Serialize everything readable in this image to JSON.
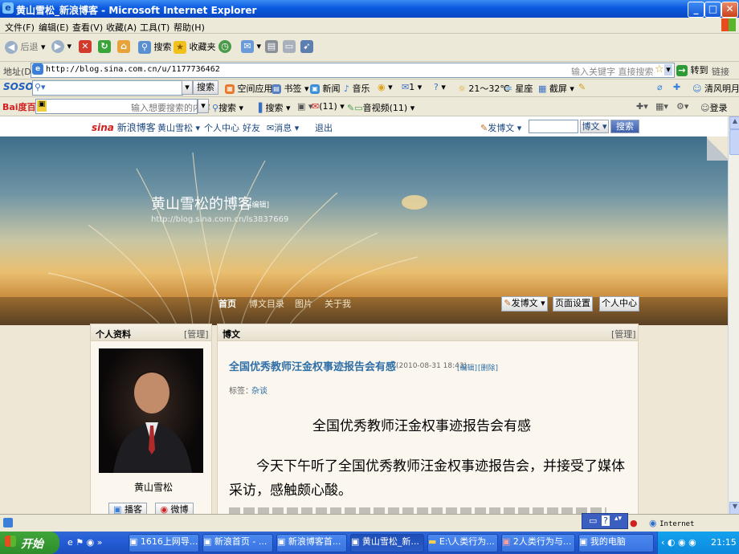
{
  "window": {
    "title": "黄山雪松_新浪博客 - Microsoft Internet Explorer",
    "min": "_",
    "max": "□",
    "close": "✕"
  },
  "menu": [
    "文件(F)",
    "编辑(E)",
    "查看(V)",
    "收藏(A)",
    "工具(T)",
    "帮助(H)"
  ],
  "toolbar": {
    "back": "后退",
    "search": "搜索",
    "favorites": "收藏夹"
  },
  "address": {
    "label": "地址(D)",
    "url": "http://blog.sina.com.cn/u/1177736462",
    "hint": "输入关键字 直接搜索",
    "go": "转到",
    "links": "链接"
  },
  "soso_bar": {
    "logo": "SOSO",
    "search_btn": "搜索",
    "items": [
      "空间应用",
      "书签",
      "新闻",
      "音乐",
      "1",
      "21～32℃",
      "星座",
      "截屏"
    ],
    "user": "清风明月"
  },
  "baidu_bar": {
    "logo": "Bai度百度",
    "placeholder": "输入想要搜索的内容",
    "search_btn": "搜索",
    "items": [
      "搜索",
      "(11)",
      "音视频(11)"
    ],
    "login": "登录"
  },
  "sina_bar": {
    "logo": "新浪博客",
    "user": "黄山雪松",
    "items": [
      "个人中心",
      "好友",
      "消息",
      "退出"
    ],
    "post": "发博文",
    "search_scope": "博文",
    "search_btn": "搜索"
  },
  "blog": {
    "title": "黄山雪松的博客",
    "edit": "[编辑]",
    "url": "http://blog.sina.com.cn/ls3837669",
    "nav": [
      "首页",
      "博文目录",
      "图片",
      "关于我"
    ],
    "actions": [
      "发博文",
      "页面设置",
      "个人中心"
    ]
  },
  "profile": {
    "heading": "个人资料",
    "manage": "[管理]",
    "name": "黄山雪松",
    "btn1": "播客",
    "btn2": "微博"
  },
  "post": {
    "heading": "博文",
    "manage": "[管理]",
    "title": "全国优秀教师汪金权事迹报告会有感",
    "date": "(2010-08-31 18:43)",
    "edit": "[编辑]",
    "delete": "[删除]",
    "tag_label": "标签：",
    "tag": "杂谈",
    "body_title": "全国优秀教师汪金权事迹报告会有感",
    "para1": "今天下午听了全国优秀教师汪金权事迹报告会，并接受了媒体采访，感触颇心酸。"
  },
  "status": {
    "zone": "Internet"
  },
  "taskbar": {
    "start": "开始",
    "tasks": [
      "1616上网导...",
      "新浪首页 - ...",
      "新浪博客首...",
      "黄山雪松_新...",
      "E:\\人类行为...",
      "2人类行为与...",
      "我的电脑"
    ],
    "clock": "21:15"
  }
}
